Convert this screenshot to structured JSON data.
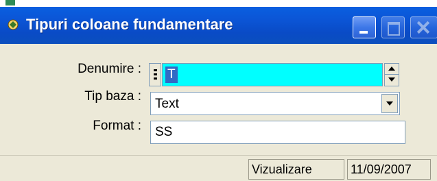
{
  "window": {
    "title": "Tipuri coloane fundamentare",
    "buttons": {
      "minimize": "minimize-icon",
      "maximize": "maximize-icon",
      "close": "close-icon"
    }
  },
  "form": {
    "denumire": {
      "label": "Denumire :",
      "value": "T",
      "background": "#00ffff"
    },
    "tip_baza": {
      "label": "Tip baza :",
      "value": "Text"
    },
    "format": {
      "label": "Format :",
      "value": "SS"
    }
  },
  "status": {
    "mode": "Vizualizare",
    "date": "11/09/2007"
  },
  "colors": {
    "titlebar": "#0a55d6",
    "window_bg": "#ece9d8",
    "selection": "#316ac5"
  }
}
